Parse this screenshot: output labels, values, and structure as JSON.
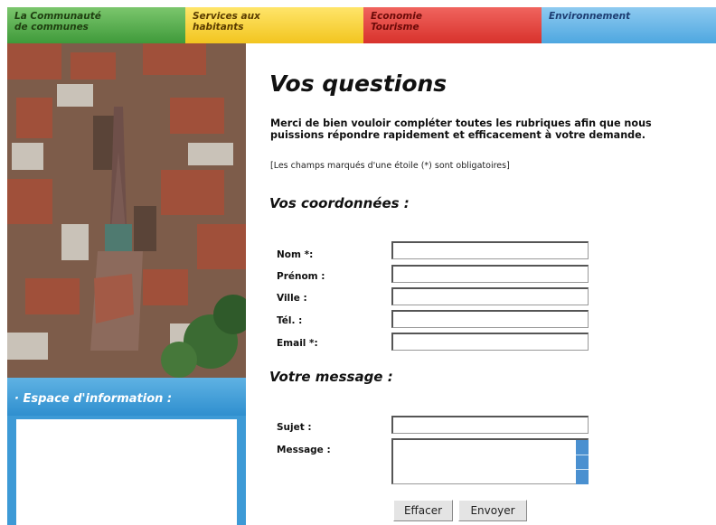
{
  "nav": {
    "tabs": [
      {
        "label_line1": "La Communauté",
        "label_line2": "de communes"
      },
      {
        "label_line1": "Services aux",
        "label_line2": "habitants"
      },
      {
        "label_line1": "Economie",
        "label_line2": "Tourisme"
      },
      {
        "label_line1": "Environnement",
        "label_line2": ""
      }
    ]
  },
  "sidebar": {
    "info_title": "· Espace d'information :"
  },
  "main": {
    "title": "Vos questions",
    "intro": "Merci de bien vouloir compléter toutes les rubriques afin que nous puissions répondre rapidement et efficacement à votre demande.",
    "required_note": "[Les champs marqués d'une étoile (*) sont obligatoires]",
    "section_contact": "Vos coordonnées :",
    "section_message": "Votre message :",
    "fields": {
      "nom": {
        "label": "Nom *:",
        "value": ""
      },
      "prenom": {
        "label": "Prénom :",
        "value": ""
      },
      "ville": {
        "label": "Ville :",
        "value": ""
      },
      "tel": {
        "label": "Tél. :",
        "value": ""
      },
      "email": {
        "label": "Email *:",
        "value": ""
      },
      "sujet": {
        "label": "Sujet :",
        "value": ""
      },
      "message": {
        "label": "Message :",
        "value": ""
      }
    },
    "buttons": {
      "reset": "Effacer",
      "send": "Envoyer"
    }
  },
  "colors": {
    "tab_green": "#3f9a3a",
    "tab_yellow": "#f2c51f",
    "tab_red": "#d8322c",
    "tab_blue": "#4ea7e0",
    "sidebar_blue": "#3d9ad6"
  }
}
